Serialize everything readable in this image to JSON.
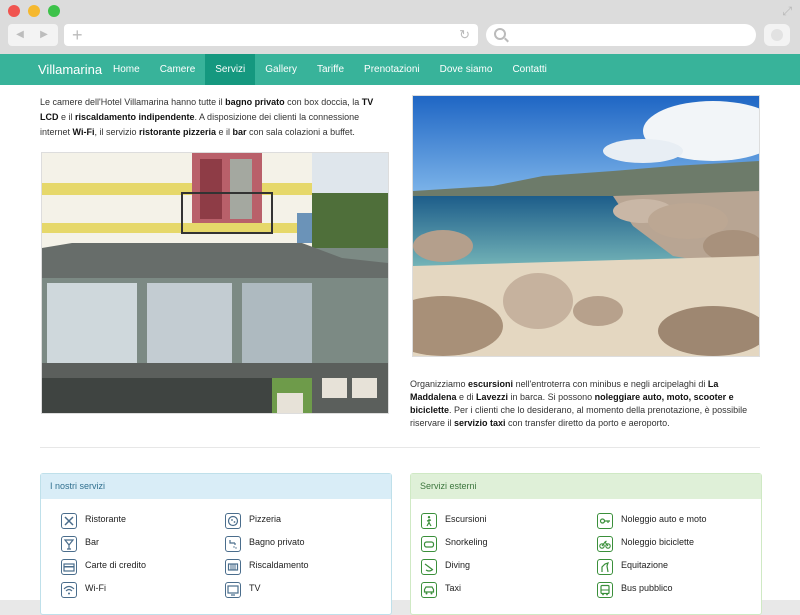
{
  "brand": "Villamarina",
  "menu": [
    {
      "label": "Home"
    },
    {
      "label": "Camere"
    },
    {
      "label": "Servizi"
    },
    {
      "label": "Gallery"
    },
    {
      "label": "Tariffe"
    },
    {
      "label": "Prenotazioni"
    },
    {
      "label": "Dove siamo"
    },
    {
      "label": "Contatti"
    }
  ],
  "active_menu": "Servizi",
  "intro": {
    "p1": "Le camere dell'Hotel Villamarina hanno tutte il ",
    "b1": "bagno privato",
    "p2": " con box doccia, la ",
    "b2": "TV LCD",
    "p3": " e il ",
    "b3": "riscaldamento indipendente",
    "p4": ". A disposizione dei clienti la connessione internet ",
    "b4": "Wi-Fi",
    "p5": ", il servizio ",
    "b5": "ristorante pizzeria",
    "p6": " e il ",
    "b6": "bar",
    "p7": " con sala colazioni a buffet."
  },
  "excursions": {
    "p1": "Organizziamo ",
    "b1": "escursioni",
    "p2": " nell'entroterra con minibus e negli arcipelaghi di ",
    "b2": "La Maddalena",
    "p3": " e di ",
    "b3": "Lavezzi",
    "p4": " in barca. Si possono ",
    "b4": "noleggiare auto, moto, scooter e biciclette",
    "p5": ". Per i clienti che lo desiderano, al momento della prenotazione, è possibile riservare il ",
    "b5": "servizio taxi",
    "p6": " con transfer diretto da porto e aeroporto."
  },
  "panels": {
    "internal": {
      "title": "I nostri servizi",
      "col1": [
        {
          "label": "Ristorante",
          "icon": "restaurant-icon"
        },
        {
          "label": "Bar",
          "icon": "bar-icon"
        },
        {
          "label": "Carte di credito",
          "icon": "credit-card-icon"
        },
        {
          "label": "Wi-Fi",
          "icon": "wifi-icon"
        }
      ],
      "col2": [
        {
          "label": "Pizzeria",
          "icon": "pizza-icon"
        },
        {
          "label": "Bagno privato",
          "icon": "shower-icon"
        },
        {
          "label": "Riscaldamento",
          "icon": "heating-icon"
        },
        {
          "label": "TV",
          "icon": "tv-icon"
        }
      ]
    },
    "external": {
      "title": "Servizi esterni",
      "col1": [
        {
          "label": "Escursioni",
          "icon": "hiking-icon"
        },
        {
          "label": "Snorkeling",
          "icon": "snorkel-mask-icon"
        },
        {
          "label": "Diving",
          "icon": "diving-icon"
        },
        {
          "label": "Taxi",
          "icon": "taxi-icon"
        }
      ],
      "col2": [
        {
          "label": "Noleggio auto e moto",
          "icon": "car-key-icon"
        },
        {
          "label": "Noleggio biciclette",
          "icon": "bicycle-icon"
        },
        {
          "label": "Equitazione",
          "icon": "horse-icon"
        },
        {
          "label": "Bus pubblico",
          "icon": "bus-icon"
        }
      ]
    }
  },
  "colors": {
    "navbar": "#38b39a",
    "navbar_active": "#15987f",
    "panel_blue_head": "#d9edf7",
    "panel_green_head": "#dff0d8"
  }
}
